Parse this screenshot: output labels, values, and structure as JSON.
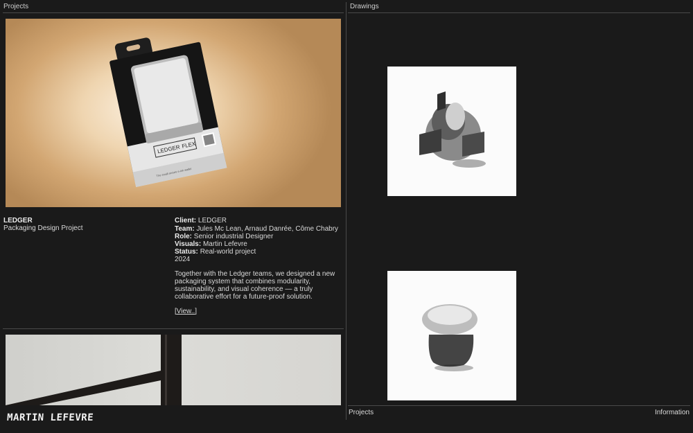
{
  "header": {
    "projects_label": "Projects",
    "drawings_label": "Drawings"
  },
  "project": {
    "title": "LEDGER",
    "subtitle": "Packaging Design Project",
    "client_label": "Client:",
    "client": "LEDGER",
    "team_label": "Team:",
    "team": "Jules Mc Lean, Arnaud Danrée, Côme Chabry",
    "role_label": "Role:",
    "role": "Senior industrial Designer",
    "visuals_label": "Visuals:",
    "visuals": "Martin Lefevre",
    "status_label": "Status:",
    "status": "Real-world project",
    "year": "2024",
    "description": "Together with the Ledger teams, we designed a new packaging system that combines modularity, sustainability, and visual coherence — a truly collaborative effort for a future-proof solution.",
    "view_link": "[View..]"
  },
  "product": {
    "brand": "LEDGER",
    "model": "FLEX",
    "tagline": "The small secure e-ink wallet"
  },
  "footer": {
    "logo_text": "MARTIN LEFEVRE",
    "projects_link": "Projects",
    "information_link": "Information"
  },
  "colors": {
    "background": "#1a1a1a",
    "rule": "#4a4a4a",
    "text": "#d9d9d9"
  }
}
